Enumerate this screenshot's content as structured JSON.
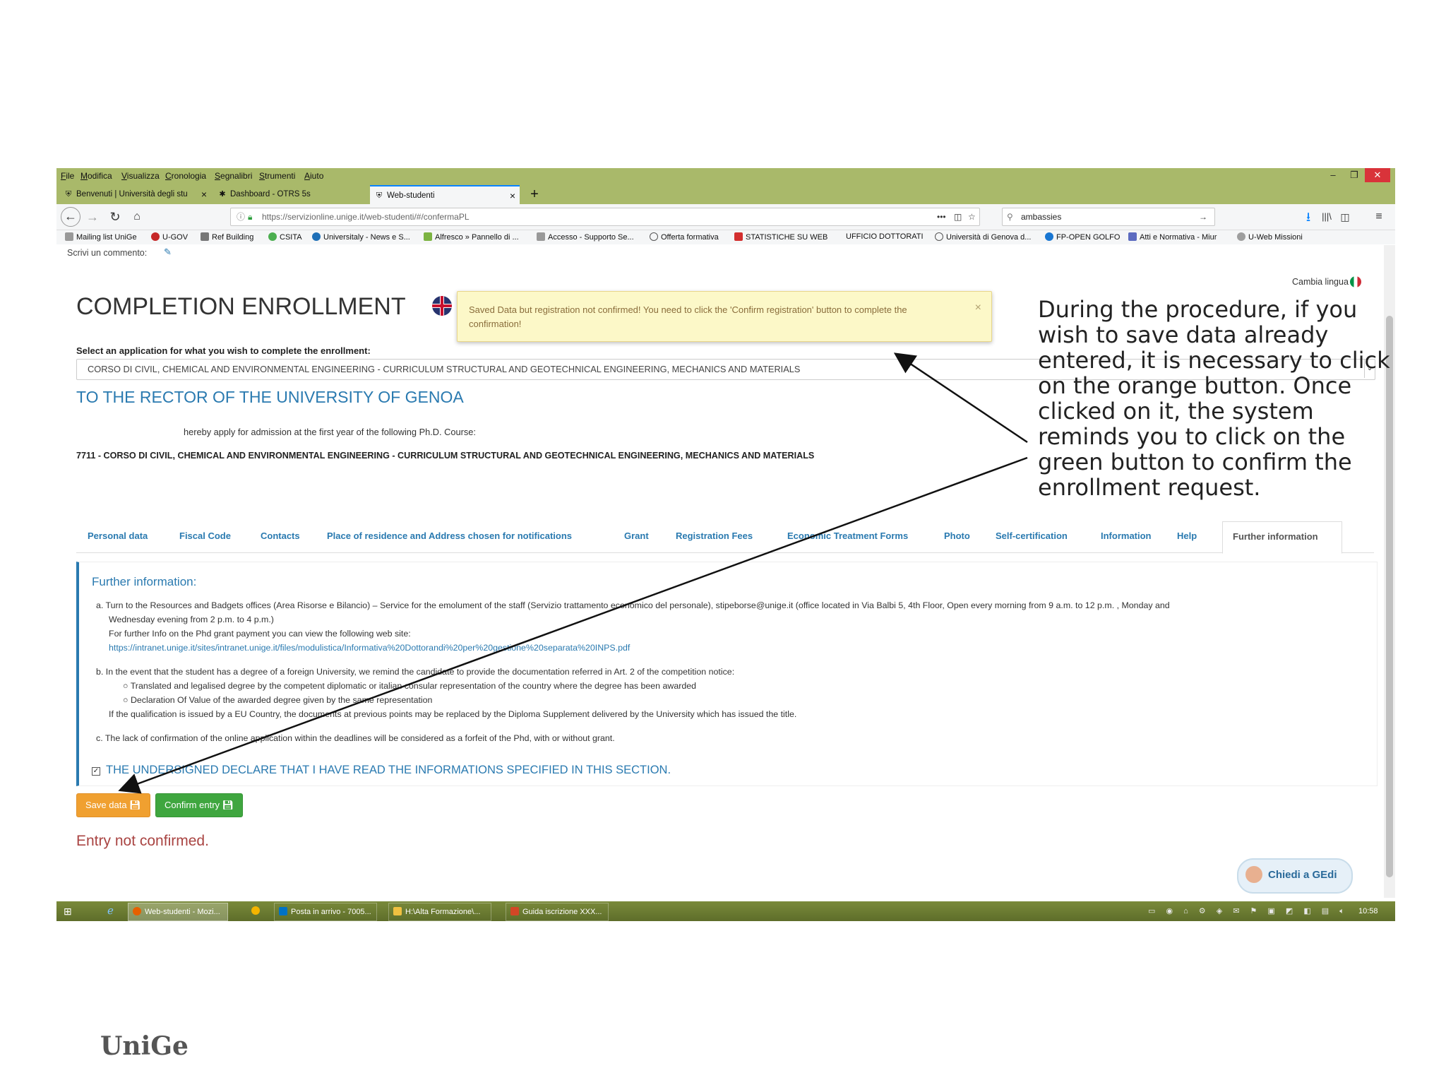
{
  "menubar": {
    "items": [
      "File",
      "Modifica",
      "Visualizza",
      "Cronologia",
      "Segnalibri",
      "Strumenti",
      "Aiuto"
    ]
  },
  "tabs": [
    {
      "label": "Benvenuti | Università degli stu"
    },
    {
      "label": "Dashboard - OTRS 5s"
    },
    {
      "label": "Web-studenti"
    }
  ],
  "navbar": {
    "url": "https://servizionline.unige.it/web-studenti/#/confermaPL",
    "search": "ambassies",
    "more": "•••"
  },
  "bookmarks": [
    "Mailing list UniGe",
    "U-GOV",
    "Ref Building",
    "CSITA",
    "Universitaly - News e S...",
    "Alfresco » Pannello di ...",
    "Accesso - Supporto Se...",
    "Offerta formativa",
    "STATISTICHE SU WEB",
    "UFFICIO DOTTORATI",
    "Università di Genova d...",
    "FP-OPEN GOLFO",
    "Atti e Normativa - Miur",
    "U-Web Missioni"
  ],
  "page": {
    "comment": "Scrivi un commento:",
    "change_language": "Cambia lingua",
    "title": "COMPLETION ENROLLMENT",
    "alert": "Saved Data but registration not confirmed! You need to click the 'Confirm registration' button to complete the confirmation!",
    "alert_close": "×",
    "select_label": "Select an application for what you wish to complete the enrollment:",
    "select_value": "CORSO DI CIVIL, CHEMICAL AND ENVIRONMENTAL ENGINEERING - CURRICULUM STRUCTURAL AND GEOTECHNICAL ENGINEERING, MECHANICS AND MATERIALS",
    "rector": "TO THE RECTOR OF THE UNIVERSITY OF GENOA",
    "apply": "hereby apply for admission at the first year of the following Ph.D. Course:",
    "course": "7711 - CORSO DI CIVIL, CHEMICAL AND ENVIRONMENTAL ENGINEERING - CURRICULUM STRUCTURAL AND GEOTECHNICAL ENGINEERING, MECHANICS AND MATERIALS",
    "nav_tabs": [
      "Personal data",
      "Fiscal Code",
      "Contacts",
      "Place of residence and Address chosen for notifications",
      "Grant",
      "Registration Fees",
      "Economic Treatment Forms",
      "Photo",
      "Self-certification",
      "Information",
      "Help",
      "Further information"
    ],
    "further_title": "Further information:",
    "item_a1": "a.  Turn to the Resources and Badgets offices (Area Risorse e Bilancio) – Service for the emolument of the staff (Servizio trattamento economico del personale), stipeborse@unige.it (office located in Via Balbi 5, 4th Floor, Open every morning from 9 a.m. to 12 p.m. , Monday and",
    "item_a2": "Wednesday evening from 2 p.m. to 4 p.m.)",
    "item_a3": "For further Info on the Phd grant payment you can view the following web site:",
    "item_a_link": "https://intranet.unige.it/sites/intranet.unige.it/files/modulistica/Informativa%20Dottorandi%20per%20gestione%20separata%20INPS.pdf",
    "item_b1": "b.  In the event that the student has a degree of a foreign University, we remind the candidate to provide the documentation referred in Art. 2 of the competition notice:",
    "item_b2": "Translated and legalised degree by the competent diplomatic or italian consular representation of the country where the degree has been awarded",
    "item_b3": "Declaration Of Value of the awarded degree given by the same representation",
    "item_b4": "If the qualification is issued by a EU Country, the documents at previous points may be replaced by the Diploma Supplement delivered by the University which has issued the title.",
    "item_c": "c.  The lack of confirmation of the online application within the deadlines will be considered as a forfeit of the Phd, with or without grant.",
    "declare": "THE UNDERSIGNED DECLARE THAT I HAVE  READ THE INFORMATIONS SPECIFIED IN THIS SECTION.",
    "save_btn": "Save data",
    "confirm_btn": "Confirm entry",
    "not_confirmed": "Entry not confirmed.",
    "chat_btn": "Chiedi a GEdi"
  },
  "taskbar": [
    "Web-studenti - Mozi...",
    "Posta in arrivo - 7005...",
    "H:\\Alta Formazione\\...",
    "Guida iscrizione XXX..."
  ],
  "clock": "10:58",
  "annotation": "During the procedure, if you wish to save data already entered, it is necessary to click on the orange button. Once clicked on it, the system reminds you to click on the green button to confirm the enrollment request.",
  "logo": "UniGe",
  "colors": {
    "orange": "#f0a030",
    "green": "#3fa63f",
    "blue_link": "#2a7ab0",
    "alert_bg": "#fcf8c8",
    "error_red": "#a94442"
  }
}
